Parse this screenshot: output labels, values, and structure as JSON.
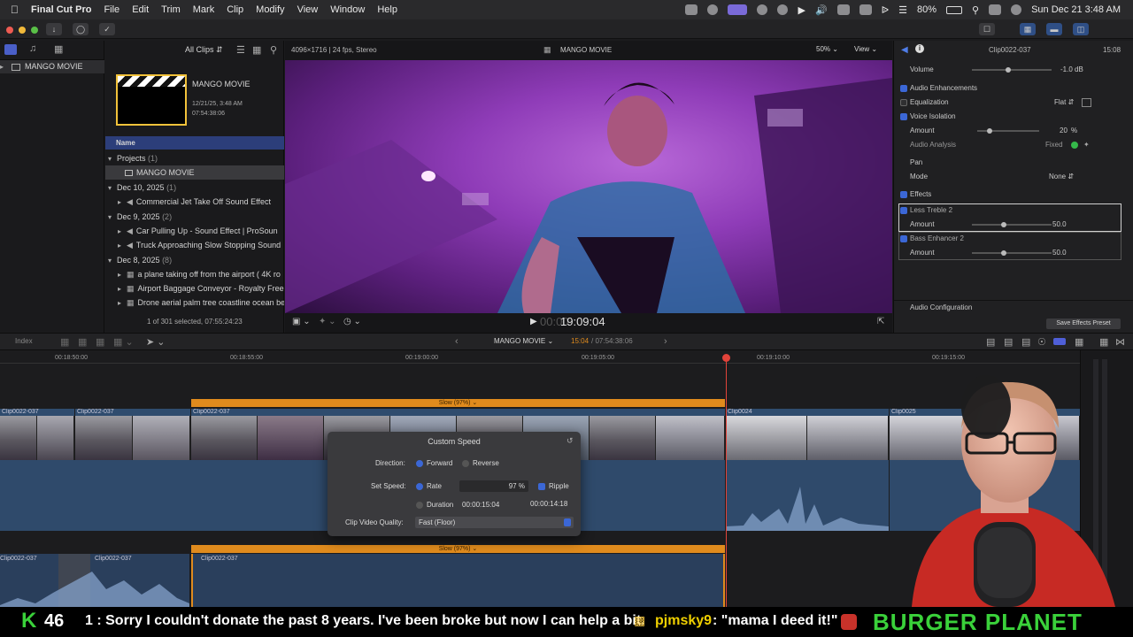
{
  "menubar": {
    "app_name": "Final Cut Pro",
    "items": [
      "File",
      "Edit",
      "Trim",
      "Mark",
      "Clip",
      "Modify",
      "View",
      "Window",
      "Help"
    ],
    "battery": "80%",
    "datetime": "Sun Dec 21  3:48 AM"
  },
  "library": {
    "item": "MANGO MOVIE"
  },
  "browser": {
    "filter": "All Clips",
    "project_card": {
      "title": "MANGO MOVIE",
      "date": "12/21/25, 3:48 AM",
      "duration": "07:54:38:06"
    },
    "column_header": "Name",
    "groups": [
      {
        "label": "Projects",
        "count": "(1)",
        "items": [
          "MANGO MOVIE"
        ]
      },
      {
        "label": "Dec 10, 2025",
        "count": "(1)",
        "items": [
          "Commercial Jet Take Off Sound Effect"
        ]
      },
      {
        "label": "Dec 9, 2025",
        "count": "(2)",
        "items": [
          "Car Pulling Up - Sound Effect  |  ProSoun",
          "Truck Approaching Slow Stopping Sound"
        ]
      },
      {
        "label": "Dec 8, 2025",
        "count": "(8)",
        "items": [
          "a plane taking off from the airport ( 4K ro",
          "Airport Baggage Conveyor - Royalty Free",
          "Drone aerial palm tree coastline ocean be"
        ]
      }
    ],
    "selection_status": "1 of 301 selected, 07:55:24:23"
  },
  "viewer": {
    "format": "4096×1716 | 24 fps, Stereo",
    "title": "MANGO MOVIE",
    "zoom": "50%",
    "view_label": "View",
    "timecode": "19:09:04",
    "timecode_prefix": "00:00"
  },
  "inspector": {
    "clip_name": "Clip0022-037",
    "duration": "15:08",
    "volume_label": "Volume",
    "volume_value": "-1.0  dB",
    "section_enhancements": "Audio Enhancements",
    "equalization_label": "Equalization",
    "equalization_value": "Flat",
    "voice_isolation_label": "Voice Isolation",
    "amount_label": "Amount",
    "voice_amount": "20",
    "percent": "%",
    "audio_analysis_label": "Audio Analysis",
    "audio_analysis_value": "Fixed",
    "pan_label": "Pan",
    "mode_label": "Mode",
    "mode_value": "None",
    "effects_label": "Effects",
    "effects": [
      {
        "name": "Less Treble 2",
        "amount": "50.0"
      },
      {
        "name": "Bass Enhancer 2",
        "amount": "50.0"
      }
    ],
    "audio_config_label": "Audio Configuration",
    "save_preset_label": "Save Effects Preset"
  },
  "timeline_bar": {
    "index_label": "Index",
    "project_name": "MANGO MOVIE",
    "position": "15:04",
    "total": "07:54:38:06"
  },
  "timeline": {
    "ruler": [
      "00:18:50:00",
      "00:18:55:00",
      "00:19:00:00",
      "00:19:05:00",
      "00:19:10:00",
      "00:19:15:00"
    ],
    "clips": [
      "Clip0022-037",
      "Clip0022-037",
      "Clip0022-037",
      "Clip0024",
      "Clip0025"
    ],
    "retime_label": "Slow (97%)",
    "lower_clips": [
      "Clip0022-037",
      "Clip0022-037",
      "Clip0022-037"
    ]
  },
  "speed_panel": {
    "title": "Custom Speed",
    "direction_label": "Direction:",
    "forward_label": "Forward",
    "reverse_label": "Reverse",
    "set_speed_label": "Set Speed:",
    "rate_label": "Rate",
    "rate_value": "97",
    "rate_unit": "%",
    "ripple_label": "Ripple",
    "duration_label": "Duration",
    "duration_value": "00:00:15:04",
    "new_duration": "00:00:14:18",
    "quality_label": "Clip Video Quality:",
    "quality_value": "Fast (Floor)"
  },
  "ticker": {
    "count_prefix": "K",
    "count": "46",
    "message": "1 : Sorry I couldn't donate the past 8 years. I've been broke but now I can help a bit.",
    "user": "pjmsky9",
    "user_message": ": \"mama I deed it!\"",
    "brand": "BURGER PLANET"
  },
  "colors": {
    "accent_blue": "#3b67d6",
    "retime_orange": "#e08b1d",
    "video_purple": "#8f3cb8",
    "brand_green": "#3ad13a"
  }
}
